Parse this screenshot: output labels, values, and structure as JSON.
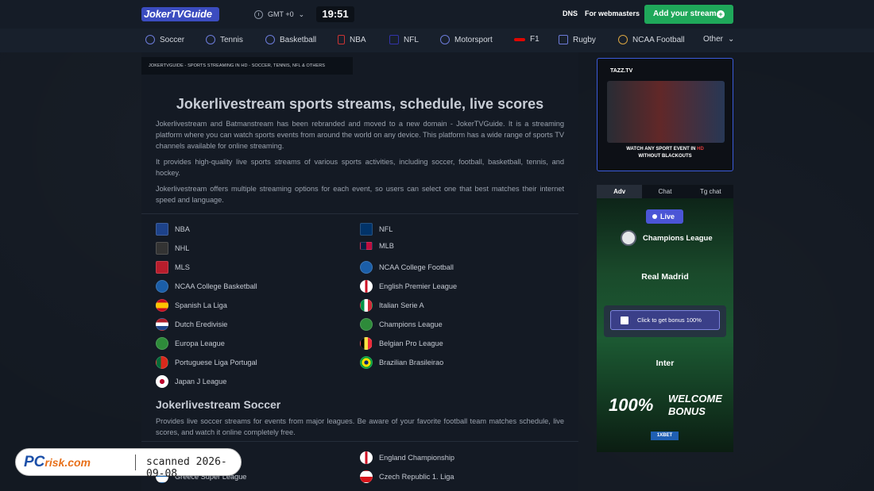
{
  "header": {
    "logo": "JokerTVGuide",
    "timezone": "GMT +0",
    "time": "19:51",
    "links": [
      "DNS",
      "For webmasters"
    ],
    "add_stream": "Add your stream"
  },
  "nav": [
    "Soccer",
    "Tennis",
    "Basketball",
    "NBA",
    "NFL",
    "Motorsport",
    "F1",
    "Rugby",
    "NCAA Football",
    "Other"
  ],
  "breadcrumb": "JOKERTVGUIDE - SPORTS STREAMING IN HD - SOCCER, TENNIS, NFL & OTHERS",
  "main": {
    "title": "Jokerlivestream sports streams, schedule, live scores",
    "paragraphs": [
      "Jokerlivestream and Batmanstream has been rebranded and moved to a new domain - JokerTVGuide. It is a streaming platform where you can watch sports events from around the world on any device. This platform has a wide range of sports TV channels available for online streaming.",
      "It provides high-quality live sports streams of various sports activities, including soccer, football, basketball, tennis, and hockey.",
      "Jokerlivestream offers multiple streaming options for each event, so users can select one that best matches their internet speed and language."
    ],
    "leagues_left": [
      "NBA",
      "NHL",
      "MLS",
      "NCAA College Basketball",
      "Spanish La Liga",
      "Dutch Eredivisie",
      "Europa League",
      "Portuguese Liga Portugal",
      "Japan J League"
    ],
    "leagues_right": [
      "NFL",
      "MLB",
      "NCAA College Football",
      "English Premier League",
      "Italian Serie A",
      "Champions League",
      "Belgian Pro League",
      "Brazilian Brasileirao"
    ],
    "soccer_title": "Jokerlivestream Soccer",
    "soccer_text": "Provides live soccer streams for events from major leagues. Be aware of your favorite football team matches schedule, live scores, and watch it online completely free.",
    "soccer_left": [
      "Greece Super League"
    ],
    "soccer_right": [
      "England Championship",
      "Czech Republic 1. Liga"
    ]
  },
  "sidebar": {
    "ad_brand": "TAZZ.TV",
    "ad_caption_1": "WATCH ANY SPORT EVENT IN",
    "ad_caption_hd": "HD",
    "ad_caption_2": "WITHOUT BLACKOUTS",
    "tabs": [
      "Adv",
      "Chat",
      "Tg chat"
    ],
    "live": "Live",
    "competition": "Champions League",
    "home_team": "Real Madrid",
    "away_team": "Inter",
    "bonus_button": "Click to get bonus 100%",
    "bonus_pct": "100%",
    "bonus_text_1": "WELCOME",
    "bonus_text_2": "BONUS",
    "bookmaker": "1XBET"
  },
  "watermark": {
    "logo_pc": "PC",
    "logo_risk": "risk.com",
    "scanned": "scanned 2026-09-08"
  }
}
